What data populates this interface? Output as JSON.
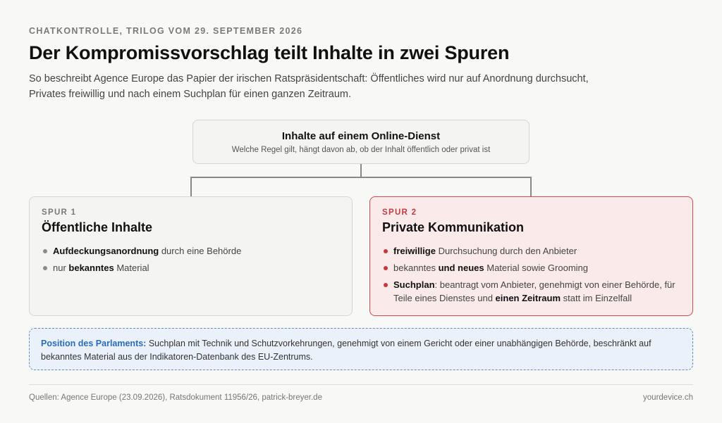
{
  "header": {
    "kicker": "CHATKONTROLLE, TRILOG VOM 29. SEPTEMBER 2026",
    "title": "Der Kompromissvorschlag teilt Inhalte in zwei Spuren",
    "subtitle": "So beschreibt Agence Europe das Papier der irischen Ratspräsidentschaft: Öffentliches wird nur auf Anordnung durchsucht, Privates freiwillig und nach einem Suchplan für einen ganzen Zeitraum."
  },
  "root": {
    "title": "Inhalte auf einem Online-Dienst",
    "subtitle": "Welche Regel gilt, hängt davon ab, ob der Inhalt öffentlich oder privat ist"
  },
  "lanes": [
    {
      "label": "SPUR 1",
      "title": "Öffentliche Inhalte",
      "items": [
        {
          "bold": "Aufdeckungsanordnung",
          "rest": " durch eine Behörde"
        },
        {
          "pre": "nur ",
          "bold": "bekanntes",
          "rest": " Material"
        }
      ]
    },
    {
      "label": "SPUR 2",
      "title": "Private Kommunikation",
      "items": [
        {
          "bold": "freiwillige",
          "rest": " Durchsuchung durch den Anbieter"
        },
        {
          "pre": "bekanntes ",
          "bold": "und neues",
          "rest": " Material sowie Grooming"
        },
        {
          "bold": "Suchplan",
          "rest": ": beantragt vom Anbieter, genehmigt von einer Behörde, für Teile eines Dienstes und ",
          "bold2": "einen Zeitraum",
          "rest2": " statt im Einzelfall"
        }
      ]
    }
  ],
  "note": {
    "label": "Position des Parlaments:",
    "text": " Suchplan mit Technik und Schutzvorkehrungen, genehmigt von einem Gericht oder einer unabhängigen Behörde, beschränkt auf bekanntes Material aus der Indikatoren-Datenbank des EU-Zentrums."
  },
  "footer": {
    "sources": "Quellen: Agence Europe (23.09.2026), Ratsdokument 11956/26, patrick-breyer.de",
    "brand": "yourdevice.ch"
  },
  "colors": {
    "accent_red": "#c23b3e",
    "accent_blue": "#2a6cc4"
  }
}
